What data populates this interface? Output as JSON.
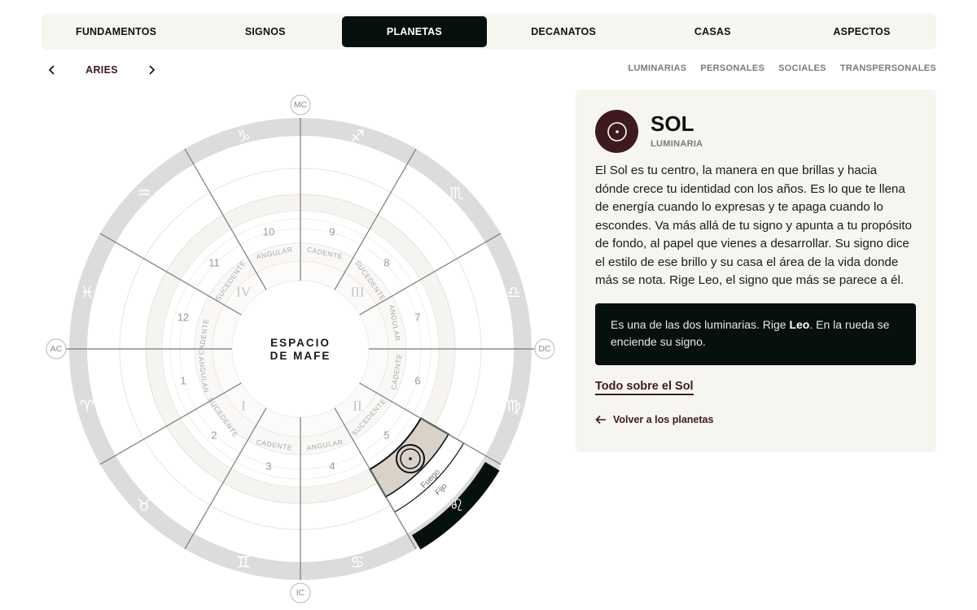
{
  "nav": {
    "tabs": [
      {
        "label": "FUNDAMENTOS",
        "active": false
      },
      {
        "label": "SIGNOS",
        "active": false
      },
      {
        "label": "PLANETAS",
        "active": true
      },
      {
        "label": "DECANATOS",
        "active": false
      },
      {
        "label": "CASAS",
        "active": false
      },
      {
        "label": "ASPECTOS",
        "active": false
      }
    ]
  },
  "sign_selector": {
    "current": "ARIES",
    "prev_icon": "chevron-left-icon",
    "next_icon": "chevron-right-icon"
  },
  "filters": [
    "LUMINARIAS",
    "PERSONALES",
    "SOCIALES",
    "TRANSPERSONALES"
  ],
  "wheel": {
    "center_line1": "ESPACIO",
    "center_line2": "DE MAFE",
    "angles": {
      "top": "MC",
      "left": "AC",
      "right": "DC",
      "bottom": "IC"
    },
    "houses": [
      "1",
      "2",
      "3",
      "4",
      "5",
      "6",
      "7",
      "8",
      "9",
      "10",
      "11",
      "12"
    ],
    "quadrants": [
      "I",
      "II",
      "III",
      "IV"
    ],
    "modalities": [
      "ANGULAR",
      "SUCEDENTE",
      "CADENTE"
    ],
    "highlight": {
      "element": "Fuego",
      "modality": "Fijo"
    },
    "colors": {
      "ring": "#dcdcdc",
      "highlight_dark": "#06110f",
      "highlight_light": "#d8d2c8",
      "accent": "#e8b9b0"
    }
  },
  "planet": {
    "name": "SOL",
    "category": "LUMINARIA",
    "icon": "sun-icon",
    "description": "El Sol es tu centro, la manera en que brillas y hacia dónde crece tu identidad con los años. Es lo que te llena de energía cuando lo expresas y te apaga cuando lo escondes. Va más allá de tu signo y apunta a tu propósito de fondo, al papel que vienes a desarrollar. Su signo dice el estilo de ese brillo y su casa el área de la vida donde más se nota. Rige Leo, el signo que más se parece a él.",
    "note_prefix": "Es una de las dos luminarias. Rige ",
    "note_bold": "Leo",
    "note_suffix": ". En la rueda se enciende su signo.",
    "more_link": "Todo sobre el Sol",
    "back_link": "Volver a los planetas"
  },
  "colors": {
    "brand_dark": "#06110f",
    "burgundy": "#3e1a1e",
    "panel": "#f7f5ef"
  }
}
